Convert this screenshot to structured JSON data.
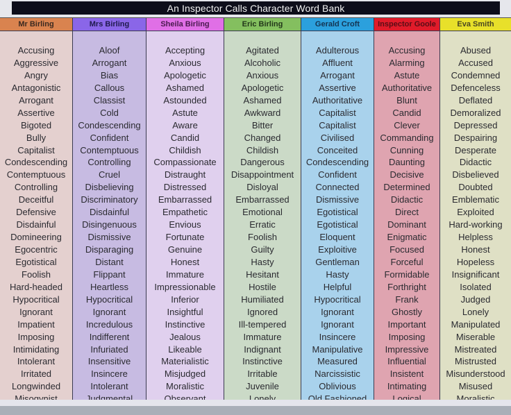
{
  "title": "An Inspector Calls Character Word Bank",
  "columns": [
    {
      "name": "Mr Birling",
      "header_color": "#d9834f",
      "header_text_color": "#3b2a20",
      "body_color": "#e4d0cf",
      "words": [
        "Accusing",
        "Aggressive",
        "Angry",
        "Antagonistic",
        "Arrogant",
        "Assertive",
        "Bigoted",
        "Bully",
        "Capitalist",
        "Condescending",
        "Contemptuous",
        "Controlling",
        "Deceitful",
        "Defensive",
        "Disdainful",
        "Domineering",
        "Egocentric",
        "Egotistical",
        "Foolish",
        "Hard-headed",
        "Hypocritical",
        "Ignorant",
        "Impatient",
        "Imposing",
        "Intimidating",
        "Intolerant",
        "Irritated",
        "Longwinded",
        "Misogynist"
      ]
    },
    {
      "name": "Mrs Birling",
      "header_color": "#8a66e8",
      "header_text_color": "#1f1a4d",
      "body_color": "#c7bbe2",
      "words": [
        "Aloof",
        "Arrogant",
        "Bias",
        "Callous",
        "Classist",
        "Cold",
        "Condescending",
        "Confident",
        "Contemptuous",
        "Controlling",
        "Cruel",
        "Disbelieving",
        "Discriminatory",
        "Disdainful",
        "Disingenuous",
        "Dismissive",
        "Disparaging",
        "Distant",
        "Flippant",
        "Heartless",
        "Hypocritical",
        "Ignorant",
        "Incredulous",
        "Indifferent",
        "Infuriated",
        "Insensitive",
        "Insincere",
        "Intolerant",
        "Judgmental"
      ]
    },
    {
      "name": "Sheila Birling",
      "header_color": "#e06fe6",
      "header_text_color": "#4a1a4f",
      "body_color": "#e0d0ee",
      "words": [
        "Accepting",
        "Anxious",
        "Apologetic",
        "Ashamed",
        "Astounded",
        "Astute",
        "Aware",
        "Candid",
        "Childish",
        "Compassionate",
        "Distraught",
        "Distressed",
        "Embarrassed",
        "Empathetic",
        "Envious",
        "Fortunate",
        "Genuine",
        "Honest",
        "Immature",
        "Impressionable",
        "Inferior",
        "Insightful",
        "Instinctive",
        "Jealous",
        "Likeable",
        "Materialistic",
        "Misjudged",
        "Moralistic",
        "Observant"
      ]
    },
    {
      "name": "Eric Birling",
      "header_color": "#84bf5f",
      "header_text_color": "#23381a",
      "body_color": "#cbdac7",
      "words": [
        "Agitated",
        "Alcoholic",
        "Anxious",
        "Apologetic",
        "Ashamed",
        "Awkward",
        "Bitter",
        "Changed",
        "Childish",
        "Dangerous",
        "Disappointment",
        "Disloyal",
        "Embarrassed",
        "Emotional",
        "Erratic",
        "Foolish",
        "Guilty",
        "Hasty",
        "Hesitant",
        "Hostile",
        "Humiliated",
        "Ignored",
        "Ill-tempered",
        "Immature",
        "Indignant",
        "Instinctive",
        "Irritable",
        "Juvenile",
        "Lonely"
      ]
    },
    {
      "name": "Gerald Croft",
      "header_color": "#2ba0dd",
      "header_text_color": "#143452",
      "body_color": "#a9d2ec",
      "words": [
        "Adulterous",
        "Affluent",
        "Arrogant",
        "Assertive",
        "Authoritative",
        "Capitalist",
        "Capitalist",
        "Civilised",
        "Conceited",
        "Condescending",
        "Confident",
        "Connected",
        "Dismissive",
        "Egotistical",
        "Egotistical",
        "Eloquent",
        "Exploitive",
        "Gentleman",
        "Hasty",
        "Helpful",
        "Hypocritical",
        "Ignorant",
        "Ignorant",
        "Insincere",
        "Manipulative",
        "Measured",
        "Narcissistic",
        "Oblivious",
        "Old Fashioned"
      ]
    },
    {
      "name": "Inspector Goole",
      "header_color": "#e01b2a",
      "header_text_color": "#5a0d16",
      "body_color": "#dfa4b0",
      "words": [
        "Accusing",
        "Alarming",
        "Astute",
        "Authoritative",
        "Blunt",
        "Candid",
        "Clever",
        "Commanding",
        "Cunning",
        "Daunting",
        "Decisive",
        "Determined",
        "Didactic",
        "Direct",
        "Dominant",
        "Enigmatic",
        "Focused",
        "Forceful",
        "Formidable",
        "Forthright",
        "Frank",
        "Ghostly",
        "Important",
        "Imposing",
        "Impressive",
        "Influential",
        "Insistent",
        "Intimating",
        "Logical"
      ]
    },
    {
      "name": "Eva Smith",
      "header_color": "#e8e02a",
      "header_text_color": "#4a4720",
      "body_color": "#dfe0c5",
      "words": [
        "Abused",
        "Accused",
        "Condemned",
        "Defenceless",
        "Deflated",
        "Demoralized",
        "Depressed",
        "Despairing",
        "Desperate",
        "Didactic",
        "Disbelieved",
        "Doubted",
        "Emblematic",
        "Exploited",
        "Hard-working",
        "Helpless",
        "Honest",
        "Hopeless",
        "Insignificant",
        "Isolated",
        "Judged",
        "Lonely",
        "Manipulated",
        "Miserable",
        "Mistreated",
        "Mistrusted",
        "Misunderstood",
        "Misused",
        "Moralistic"
      ]
    }
  ]
}
